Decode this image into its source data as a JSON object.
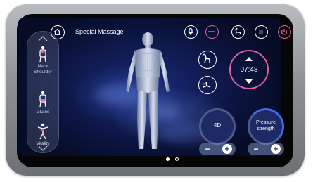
{
  "header": {
    "title": "Special Massage"
  },
  "sidebar": {
    "items": [
      {
        "label": "Neck\nShoulder",
        "icon": "neck-shoulder-massage-icon"
      },
      {
        "label": "Glutes",
        "icon": "glutes-massage-icon"
      },
      {
        "label": "Vitality",
        "icon": "vitality-massage-icon"
      }
    ]
  },
  "timer": {
    "value": "07:48"
  },
  "controls": {
    "mode_label": "4D",
    "pressure_label": "Pressure\nstrength",
    "minus": "−",
    "plus": "+"
  },
  "pagination": {
    "total": 2,
    "active": 1
  },
  "colors": {
    "accent_pink": "#e0609a",
    "accent_blue": "#3f6be0"
  }
}
